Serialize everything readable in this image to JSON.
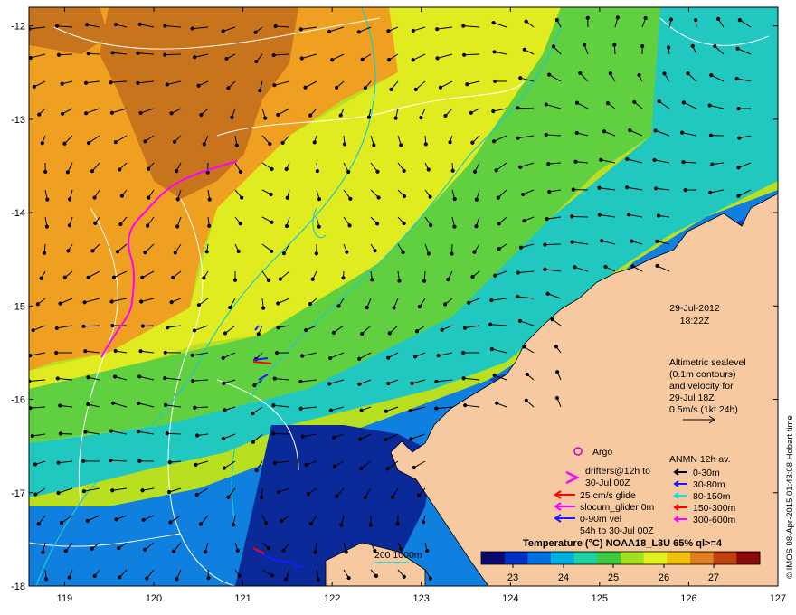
{
  "map": {
    "lon_ticks": [
      "119",
      "120",
      "121",
      "122",
      "123",
      "124",
      "125",
      "126",
      "127"
    ],
    "lat_ticks": [
      "-12",
      "-13",
      "-14",
      "-15",
      "-16",
      "-17",
      "-18"
    ],
    "lon_range": [
      118.6,
      127.0
    ],
    "lat_range": [
      -18.0,
      -11.8
    ]
  },
  "timestamp": {
    "date": "29-Jul-2012",
    "time": "18:22Z"
  },
  "altimetry_note": [
    "Altimetric sealevel",
    "(0.1m contours)",
    "and velocity for",
    "29-Jul 18Z",
    "0.5m/s (1kt 24h)"
  ],
  "legend": {
    "argo": "Argo",
    "drifters": [
      "drifters@12h to",
      "30-Jul 00Z"
    ],
    "glide": "25 cm/s glide",
    "slocum": "slocum_glider 0m",
    "vel": [
      "0-90m vel",
      "54h to 30-Jul 00Z"
    ],
    "anmn_title": "ANMN 12h av.",
    "anmn_items": [
      {
        "label": "0-30m",
        "color": "#000000"
      },
      {
        "label": "30-80m",
        "color": "#1a1aff"
      },
      {
        "label": "80-150m",
        "color": "#00e5e5"
      },
      {
        "label": "150-300m",
        "color": "#ff0000"
      },
      {
        "label": "300-600m",
        "color": "#ff00ff"
      }
    ]
  },
  "bathymetry_label": "200  1000m",
  "colorbar": {
    "title": "Temperature (°C) NOAA18_L3U 65% ql>=4",
    "ticks": [
      "23",
      "24",
      "25",
      "26",
      "27"
    ],
    "colors": [
      "#0a0a6e",
      "#0030c0",
      "#0070e0",
      "#00b0e0",
      "#20d0a0",
      "#40c840",
      "#a0e020",
      "#e0f020",
      "#f0c010",
      "#e08020",
      "#c04010",
      "#8a0a0a"
    ]
  },
  "credit": "© IMOS 08-Apr-2015 01:43:08 Hobart time",
  "colors": {
    "land": "#f7c9a0",
    "argo": "#cc00cc",
    "drifter": "#ff00ff",
    "contour": "#ffffff",
    "isobath": "#20c8c8"
  }
}
